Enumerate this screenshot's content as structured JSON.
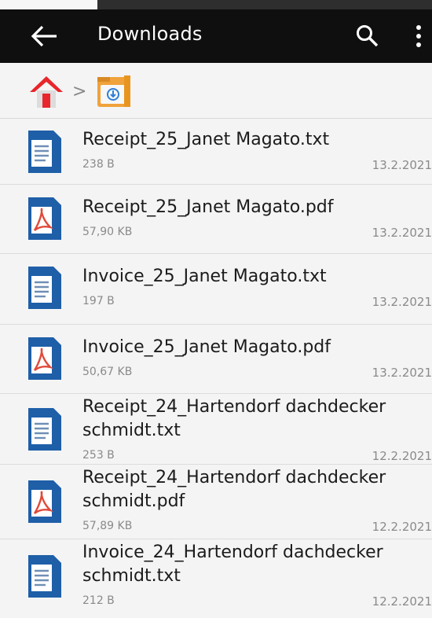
{
  "header": {
    "title": "Downloads",
    "back_icon": "arrow-left-icon",
    "search_icon": "search-icon",
    "menu_icon": "more-vertical-icon"
  },
  "breadcrumb": {
    "home_icon": "home-icon",
    "separator": ">",
    "folder_icon": "downloads-folder-icon"
  },
  "files": [
    {
      "name": "Receipt_25_Janet Magato.txt",
      "size": "238 B",
      "date": "13.2.2021",
      "icon": "text-file-icon"
    },
    {
      "name": "Receipt_25_Janet Magato.pdf",
      "size": "57,90 KB",
      "date": "13.2.2021",
      "icon": "pdf-file-icon"
    },
    {
      "name": "Invoice_25_Janet Magato.txt",
      "size": "197 B",
      "date": "13.2.2021",
      "icon": "text-file-icon"
    },
    {
      "name": "Invoice_25_Janet Magato.pdf",
      "size": "50,67 KB",
      "date": "13.2.2021",
      "icon": "pdf-file-icon"
    },
    {
      "name": "Receipt_24_Hartendorf dachdecker schmidt.txt",
      "name_line1": "Receipt_24_Hartendorf dachdecker",
      "name_line2": "schmidt.txt",
      "size": "253 B",
      "date": "12.2.2021",
      "icon": "text-file-icon"
    },
    {
      "name": "Receipt_24_Hartendorf dachdecker schmidt.pdf",
      "name_line1": "Receipt_24_Hartendorf dachdecker",
      "name_line2": "schmidt.pdf",
      "size": "57,89 KB",
      "date": "12.2.2021",
      "icon": "pdf-file-icon"
    },
    {
      "name": "Invoice_24_Hartendorf dachdecker schmidt.txt",
      "name_line1": "Invoice_24_Hartendorf dachdecker",
      "name_line2": "schmidt.txt",
      "size": "212 B",
      "date": "12.2.2021",
      "icon": "text-file-icon"
    }
  ],
  "colors": {
    "toolbar": "#0f0f0f",
    "doc_blue": "#1e5fa8",
    "pdf_red": "#e04a3a",
    "home_red": "#e8262b",
    "folder_orange": "#f0a23c"
  }
}
